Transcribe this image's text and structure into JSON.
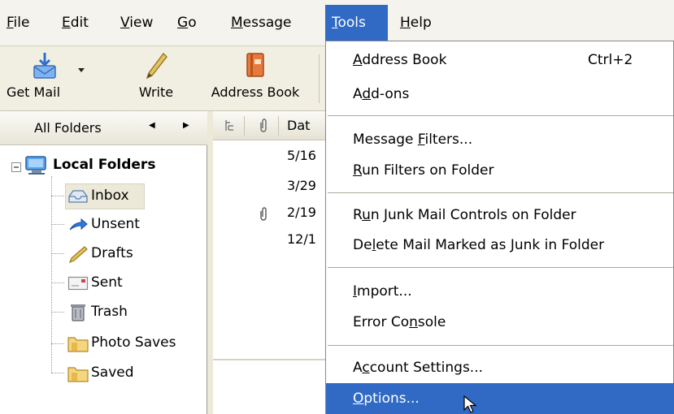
{
  "menubar": {
    "items": [
      {
        "pre": "",
        "key": "F",
        "post": "ile"
      },
      {
        "pre": "",
        "key": "E",
        "post": "dit"
      },
      {
        "pre": "",
        "key": "V",
        "post": "iew"
      },
      {
        "pre": "",
        "key": "G",
        "post": "o"
      },
      {
        "pre": "",
        "key": "M",
        "post": "essage"
      },
      {
        "pre": "",
        "key": "T",
        "post": "ools"
      },
      {
        "pre": "",
        "key": "H",
        "post": "elp"
      }
    ]
  },
  "toolbar": {
    "get_mail": "Get Mail",
    "write": "Write",
    "address_book": "Address Book"
  },
  "folders": {
    "header": "All Folders",
    "root": "Local Folders",
    "items": [
      "Inbox",
      "Unsent",
      "Drafts",
      "Sent",
      "Trash",
      "Photo Saves",
      "Saved"
    ]
  },
  "messages": {
    "date_header": "Dat",
    "dates": [
      "5/16",
      "3/29",
      "2/19",
      "12/1"
    ]
  },
  "tools_menu": {
    "items": [
      {
        "pre": "",
        "key": "A",
        "post": "ddress Book",
        "shortcut": "Ctrl+2"
      },
      {
        "pre": "A",
        "key": "d",
        "post": "d-ons",
        "shortcut": ""
      },
      {
        "pre": "Message ",
        "key": "F",
        "post": "ilters...",
        "shortcut": ""
      },
      {
        "pre": "",
        "key": "R",
        "post": "un Filters on Folder",
        "shortcut": ""
      },
      {
        "pre": "R",
        "key": "u",
        "post": "n Junk Mail Controls on Folder",
        "shortcut": ""
      },
      {
        "pre": "De",
        "key": "l",
        "post": "ete Mail Marked as Junk in Folder",
        "shortcut": ""
      },
      {
        "pre": "",
        "key": "I",
        "post": "mport...",
        "shortcut": ""
      },
      {
        "pre": "Error Co",
        "key": "n",
        "post": "sole",
        "shortcut": ""
      },
      {
        "pre": "A",
        "key": "c",
        "post": "count Settings...",
        "shortcut": ""
      },
      {
        "pre": "",
        "key": "O",
        "post": "ptions...",
        "shortcut": ""
      }
    ]
  },
  "colors": {
    "highlight": "#316ac5",
    "menubar_bg": "#f4f3ee",
    "chrome_bg": "#ece9d8"
  }
}
